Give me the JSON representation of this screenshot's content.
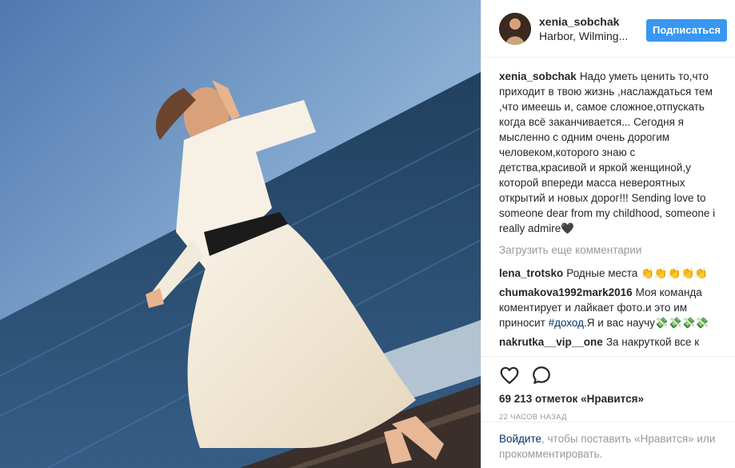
{
  "header": {
    "username": "xenia_sobchak",
    "location": "Harbor, Wilming...",
    "follow_label": "Подписаться"
  },
  "caption": {
    "author": "xenia_sobchak",
    "text": "Надо уметь ценить то,что приходит в твою жизнь ,наслаждаться тем ,что имеешь и, самое сложное,отпускать когда всё заканчивается... Сегодня я мысленно с одним очень дорогим человеком,которого знаю с детства,красивой и яркой женщиной,у которой впереди масса невероятных открытий и новых дорог!!! Sending love to someone dear from my childhood, someone i really admire🖤"
  },
  "load_more_label": "Загрузить еще комментарии",
  "comments": [
    {
      "author": "lena_trotsko",
      "text": "Родные места 👏👏👏👏👏"
    },
    {
      "author": "chumakova1992mark2016",
      "text": "Моя команда коментирует и лайкает фото.и это им приносит ",
      "hashtag": "#доход",
      "text_after": ".Я и вас научу💸💸💸💸"
    },
    {
      "author": "nakrutka__vip__one",
      "text": "За накруткой все к"
    }
  ],
  "icons": {
    "like": "heart-icon",
    "comment": "comment-bubble-icon"
  },
  "likes_text": "69 213 отметок «Нравится»",
  "timestamp": "22 часов назад",
  "login_prompt": {
    "link": "Войдите",
    "text": ", чтобы поставить «Нравится» или прокомментировать."
  },
  "colors": {
    "accent": "#3897f0",
    "link": "#003569",
    "muted": "#999999"
  }
}
